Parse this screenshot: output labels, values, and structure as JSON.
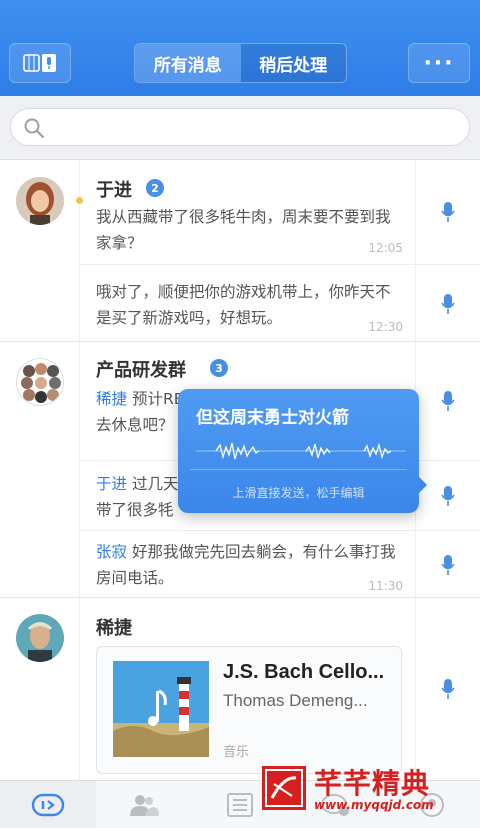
{
  "header": {
    "left_icon": "phone-mic-icon",
    "tabs": [
      {
        "label": "所有消息",
        "active": true
      },
      {
        "label": "稍后处理",
        "active": false
      }
    ],
    "more_label": "···"
  },
  "search": {
    "placeholder": "",
    "icon": "search-icon"
  },
  "conversations": [
    {
      "name": "于进",
      "badge": "2",
      "unread_dot": true,
      "messages": [
        {
          "sender": "",
          "text": "我从西藏带了很多牦牛肉，周末要不要到我家拿？",
          "time": "12:05"
        },
        {
          "sender": "",
          "text": "哦对了，顺便把你的游戏机带上，你昨天不是买了新游戏吗，好想玩。",
          "time": "12:30"
        }
      ]
    },
    {
      "name": "产品研发群",
      "badge": "3",
      "messages": [
        {
          "sender": "稀捷",
          "text": "预计RE",
          "line2": "去休息吧？",
          "time": ""
        },
        {
          "sender": "于进",
          "text": "过几天",
          "line2": "带了很多牦",
          "time": ""
        },
        {
          "sender": "张寂",
          "text": "好那我做完先回去躺会，有什么事打我房间电话。",
          "time": "11:30"
        }
      ]
    },
    {
      "name": "稀捷",
      "card": {
        "title": "J.S. Bach Cello...",
        "artist": "Thomas Demeng...",
        "type": "音乐"
      }
    }
  ],
  "voice_popup": {
    "text": "但这周末勇士对火箭",
    "hint": "上滑直接发送，松手编辑"
  },
  "tabbar": {
    "items": [
      "messages-icon",
      "contacts-icon",
      "notes-icon",
      "chat-icon",
      "profile-icon"
    ]
  },
  "watermark": {
    "title": "芊芊精典",
    "url": "www.myqqjd.com"
  },
  "colors": {
    "accent": "#2f7ee8",
    "badge": "#4a90e2",
    "watermark": "#d62020"
  }
}
